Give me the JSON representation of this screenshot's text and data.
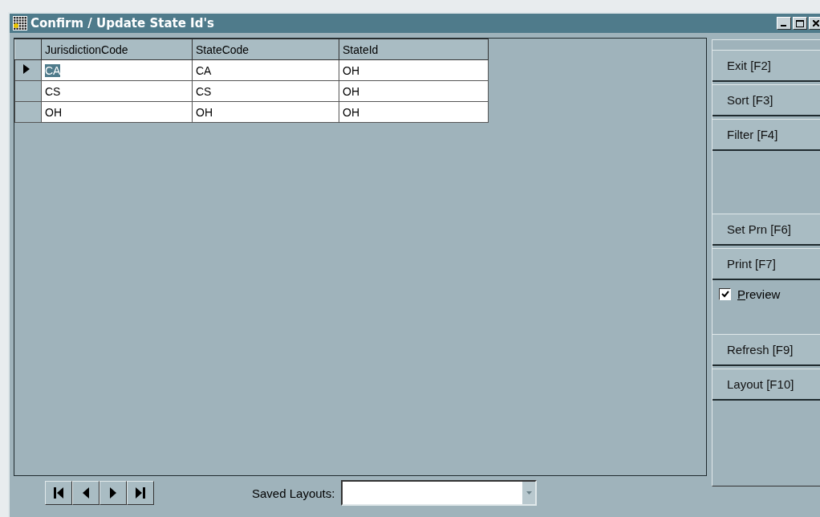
{
  "window": {
    "title": "Confirm / Update State Id's"
  },
  "grid": {
    "columns": [
      "JurisdictionCode",
      "StateCode",
      "StateId"
    ],
    "rows": [
      {
        "cells": [
          "CA",
          "CA",
          "OH"
        ],
        "selected": true
      },
      {
        "cells": [
          "CS",
          "CS",
          "OH"
        ],
        "selected": false
      },
      {
        "cells": [
          "OH",
          "OH",
          "OH"
        ],
        "selected": false
      }
    ]
  },
  "side_groups": [
    [
      {
        "kind": "button",
        "label": "Exit [F2]"
      },
      {
        "kind": "button",
        "label": "Sort [F3]"
      },
      {
        "kind": "button",
        "label": "Filter [F4]"
      }
    ],
    [
      {
        "kind": "button",
        "label": "Set Prn [F6]"
      },
      {
        "kind": "button",
        "label": "Print [F7]"
      },
      {
        "kind": "checkbox",
        "label": "Preview",
        "checked": true
      }
    ],
    [
      {
        "kind": "button",
        "label": "Refresh [F9]"
      },
      {
        "kind": "button",
        "label": "Layout [F10]"
      }
    ]
  ],
  "saved_layouts": {
    "label": "Saved Layouts:"
  }
}
